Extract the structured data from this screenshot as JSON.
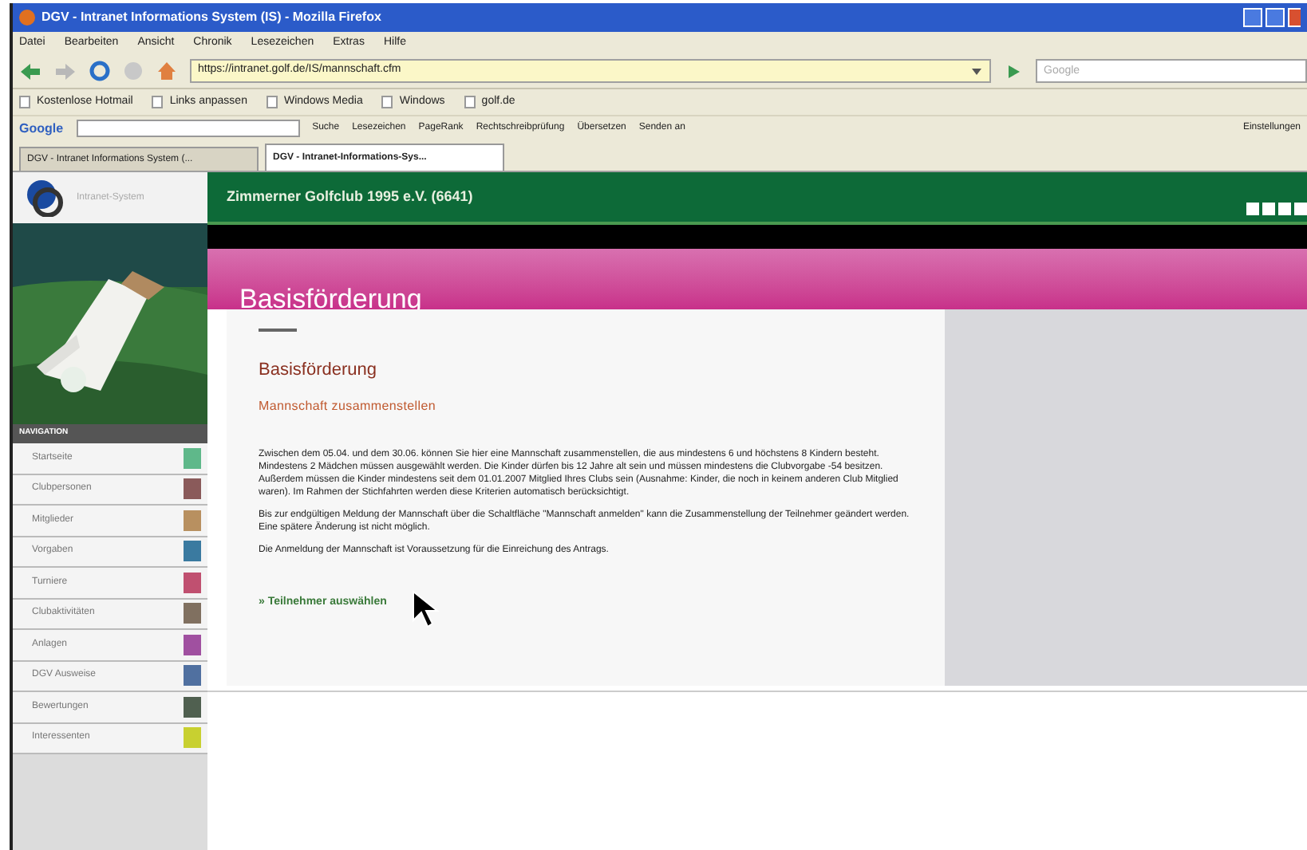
{
  "browser": {
    "title": "DGV - Intranet Informations System (IS) - Mozilla Firefox",
    "menu": [
      "Datei",
      "Bearbeiten",
      "Ansicht",
      "Chronik",
      "Lesezeichen",
      "Extras",
      "Hilfe"
    ],
    "url": "https://intranet.golf.de/IS/mannschaft.cfm",
    "search_placeholder": "Google",
    "bookmarks": [
      "Kostenlose Hotmail",
      "Links anpassen",
      "Windows Media",
      "Windows",
      "golf.de"
    ],
    "google_toolbar": {
      "logo": "Google",
      "items": [
        "Suche",
        "Lesezeichen",
        "PageRank",
        "Rechtschreibprüfung",
        "Übersetzen",
        "Senden an"
      ],
      "settings": "Einstellungen"
    },
    "tabs": [
      {
        "label": "DGV - Intranet Informations System (...",
        "selected": false
      },
      {
        "label": "DGV - Intranet-Informations-Sys...",
        "selected": true
      }
    ]
  },
  "site": {
    "logo_text": "Intranet-System",
    "club_name": "Zimmerner Golfclub 1995 e.V. (6641)",
    "page_title": "Basisförderung",
    "sidebar": {
      "heading": "NAVIGATION",
      "items": [
        {
          "label": "Startseite",
          "color": "#5fb88a"
        },
        {
          "label": "Clubpersonen",
          "color": "#8a5a5a"
        },
        {
          "label": "Mitglieder",
          "color": "#b89060"
        },
        {
          "label": "Vorgaben",
          "color": "#3a7aa0"
        },
        {
          "label": "Turniere",
          "color": "#c05070"
        },
        {
          "label": "Clubaktivitäten",
          "color": "#807060"
        },
        {
          "label": "Anlagen",
          "color": "#a050a0"
        },
        {
          "label": "DGV Ausweise",
          "color": "#5070a0"
        },
        {
          "label": "Bewertungen",
          "color": "#506050"
        },
        {
          "label": "Interessenten",
          "color": "#c8d030"
        }
      ]
    },
    "content": {
      "heading": "Basisförderung",
      "subheading": "Mannschaft zusammenstellen",
      "paragraphs": [
        "Zwischen dem 05.04. und dem 30.06. können Sie hier eine Mannschaft zusammenstellen, die aus mindestens 6 und höchstens 8 Kindern besteht. Mindestens 2 Mädchen müssen ausgewählt werden. Die Kinder dürfen bis 12 Jahre alt sein und müssen mindestens die Clubvorgabe -54 besitzen. Außerdem müssen die Kinder mindestens seit dem 01.01.2007 Mitglied Ihres Clubs sein (Ausnahme: Kinder, die noch in keinem anderen Club Mitglied waren). Im Rahmen der Stichfahrten werden diese Kriterien automatisch berücksichtigt.",
        "Bis zur endgültigen Meldung der Mannschaft über die Schaltfläche \"Mannschaft anmelden\" kann die Zusammenstellung der Teilnehmer geändert werden. Eine spätere Änderung ist nicht möglich.",
        "Die Anmeldung der Mannschaft ist Voraussetzung für die Einreichung des Antrags."
      ],
      "link": "» Teilnehmer auswählen"
    }
  }
}
